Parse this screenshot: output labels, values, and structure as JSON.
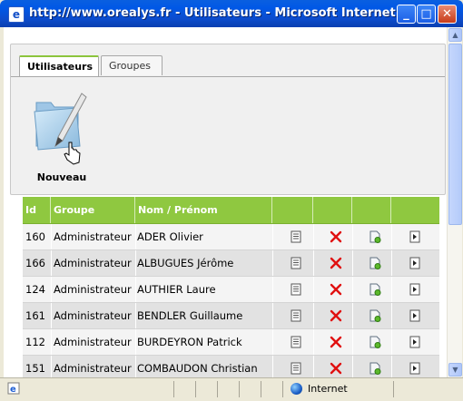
{
  "window": {
    "title": "http://www.orealys.fr - Utilisateurs - Microsoft Internet...",
    "minimize": "_",
    "maximize": "□",
    "close": "✕"
  },
  "tabs": [
    {
      "label": "Utilisateurs",
      "active": true
    },
    {
      "label": "Groupes",
      "active": false
    }
  ],
  "new_button": {
    "label": "Nouveau",
    "icon": "folder-pencil-icon"
  },
  "table": {
    "headers": [
      "Id",
      "Groupe",
      "Nom / Prénom",
      "",
      "",
      "",
      ""
    ],
    "rows": [
      {
        "id": "160",
        "groupe": "Administrateur",
        "nom": "ADER Olivier"
      },
      {
        "id": "166",
        "groupe": "Administrateur",
        "nom": "ALBUGUES Jérôme"
      },
      {
        "id": "124",
        "groupe": "Administrateur",
        "nom": "AUTHIER Laure"
      },
      {
        "id": "161",
        "groupe": "Administrateur",
        "nom": "BENDLER Guillaume"
      },
      {
        "id": "112",
        "groupe": "Administrateur",
        "nom": "BURDEYRON Patrick"
      },
      {
        "id": "151",
        "groupe": "Administrateur",
        "nom": "COMBAUDON Christian"
      }
    ],
    "row_actions": [
      "view-document-icon",
      "delete-x-icon",
      "edit-page-icon",
      "next-arrow-icon"
    ]
  },
  "statusbar": {
    "zone": "Internet"
  },
  "colors": {
    "header_green": "#8fc840",
    "delete_red": "#e01010",
    "titlebar_blue": "#0058e6"
  }
}
